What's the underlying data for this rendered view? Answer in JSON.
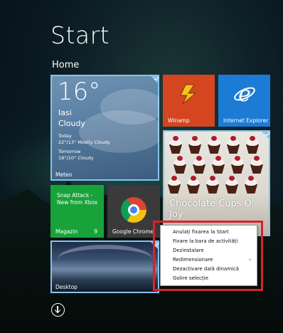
{
  "start": {
    "title": "Start",
    "group": "Home"
  },
  "tiles": {
    "weather": {
      "temp": "16°",
      "city": "Iasi",
      "condition": "Cloudy",
      "today_label": "Today",
      "today_forecast": "22°/13° Mostly Cloudy",
      "tomorrow_label": "Tomorrow",
      "tomorrow_forecast": "18°/10° Cloudy",
      "name": "Meteo"
    },
    "winamp": {
      "name": "Winamp",
      "color": "#d44520"
    },
    "ie": {
      "name": "Internet Explorer",
      "color": "#1b7bd5"
    },
    "chocolate": {
      "title": "Chocolate Cups O' Joy"
    },
    "snap": {
      "text": "Snap Attack - New from Xbox",
      "name": "Magazin",
      "count": "9",
      "color": "#18a33a"
    },
    "chrome": {
      "name": "Google Chrome"
    },
    "desktop": {
      "name": "Desktop"
    }
  },
  "context_menu": {
    "items": [
      "Anulați fixarea la Start",
      "Fixare la bara de activități",
      "Dezinstalare",
      "Redimensionare",
      "Dezactivare dală dinamică",
      "Golire selecție"
    ]
  },
  "accent": "#86c4ea",
  "highlight_color": "#d8222a"
}
